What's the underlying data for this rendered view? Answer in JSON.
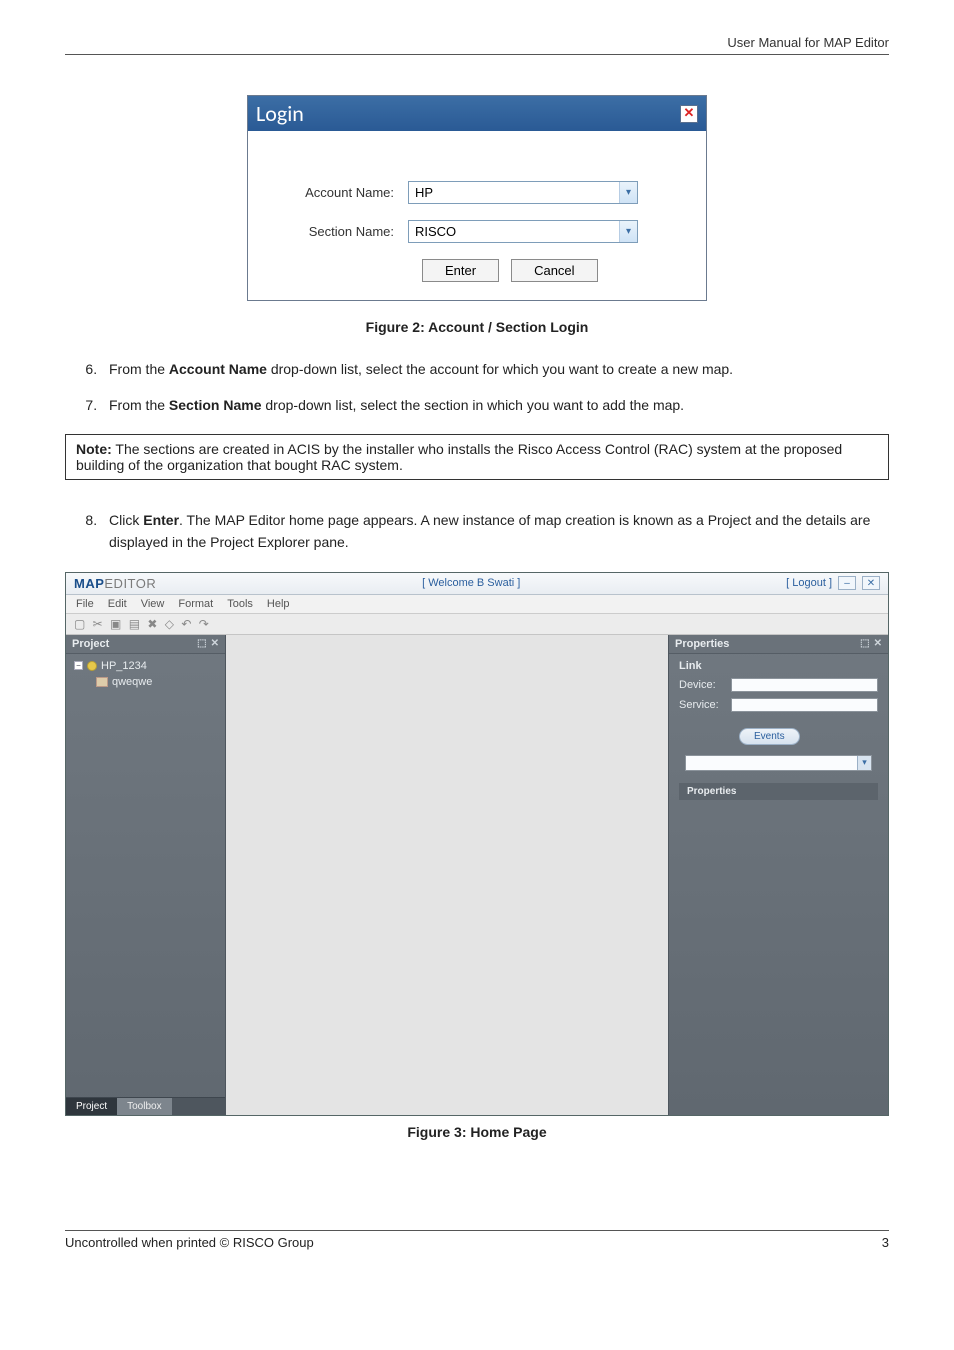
{
  "header": {
    "doc_title": "User Manual for MAP Editor"
  },
  "login": {
    "title": "Login",
    "account_label": "Account Name:",
    "section_label": "Section Name:",
    "account_value": "HP",
    "section_value": "RISCO",
    "enter": "Enter",
    "cancel": "Cancel"
  },
  "captions": {
    "fig2": "Figure 2: Account / Section Login",
    "fig3": "Figure 3: Home Page"
  },
  "steps": {
    "s6_num": "6.",
    "s6_a": "From the ",
    "s6_b": "Account Name",
    "s6_c": " drop-down list, select the account for which you want to create a new map.",
    "s7_num": "7.",
    "s7_a": "From the ",
    "s7_b": "Section Name",
    "s7_c": " drop-down list, select the section in which you want to add the map.",
    "s8_num": "8.",
    "s8_a": "Click ",
    "s8_b": "Enter",
    "s8_c": ". The MAP Editor home page appears. A new instance of map creation is known as a Project and the details are displayed in the Project Explorer pane."
  },
  "note": {
    "label": "Note:",
    "text": " The sections are created in ACIS by the installer who installs the Risco Access Control (RAC) system at the proposed building of the organization that bought RAC system."
  },
  "app": {
    "logo_bold": "MAP",
    "logo_rest": "EDITOR",
    "welcome": "[ Welcome   B Swati  ]",
    "logout": "[ Logout ]",
    "menu": {
      "file": "File",
      "edit": "Edit",
      "view": "View",
      "format": "Format",
      "tools": "Tools",
      "help": "Help"
    },
    "project_title": "Project",
    "project_item": "HP_1234",
    "project_sub": "qweqwe",
    "tab_project": "Project",
    "tab_toolbox": "Toolbox",
    "props_title": "Properties",
    "link_label": "Link",
    "device_label": "Device:",
    "service_label": "Service:",
    "events_btn": "Events",
    "props_sub": "Properties"
  },
  "footer": {
    "left": "Uncontrolled when printed © RISCO Group",
    "right": "3"
  }
}
